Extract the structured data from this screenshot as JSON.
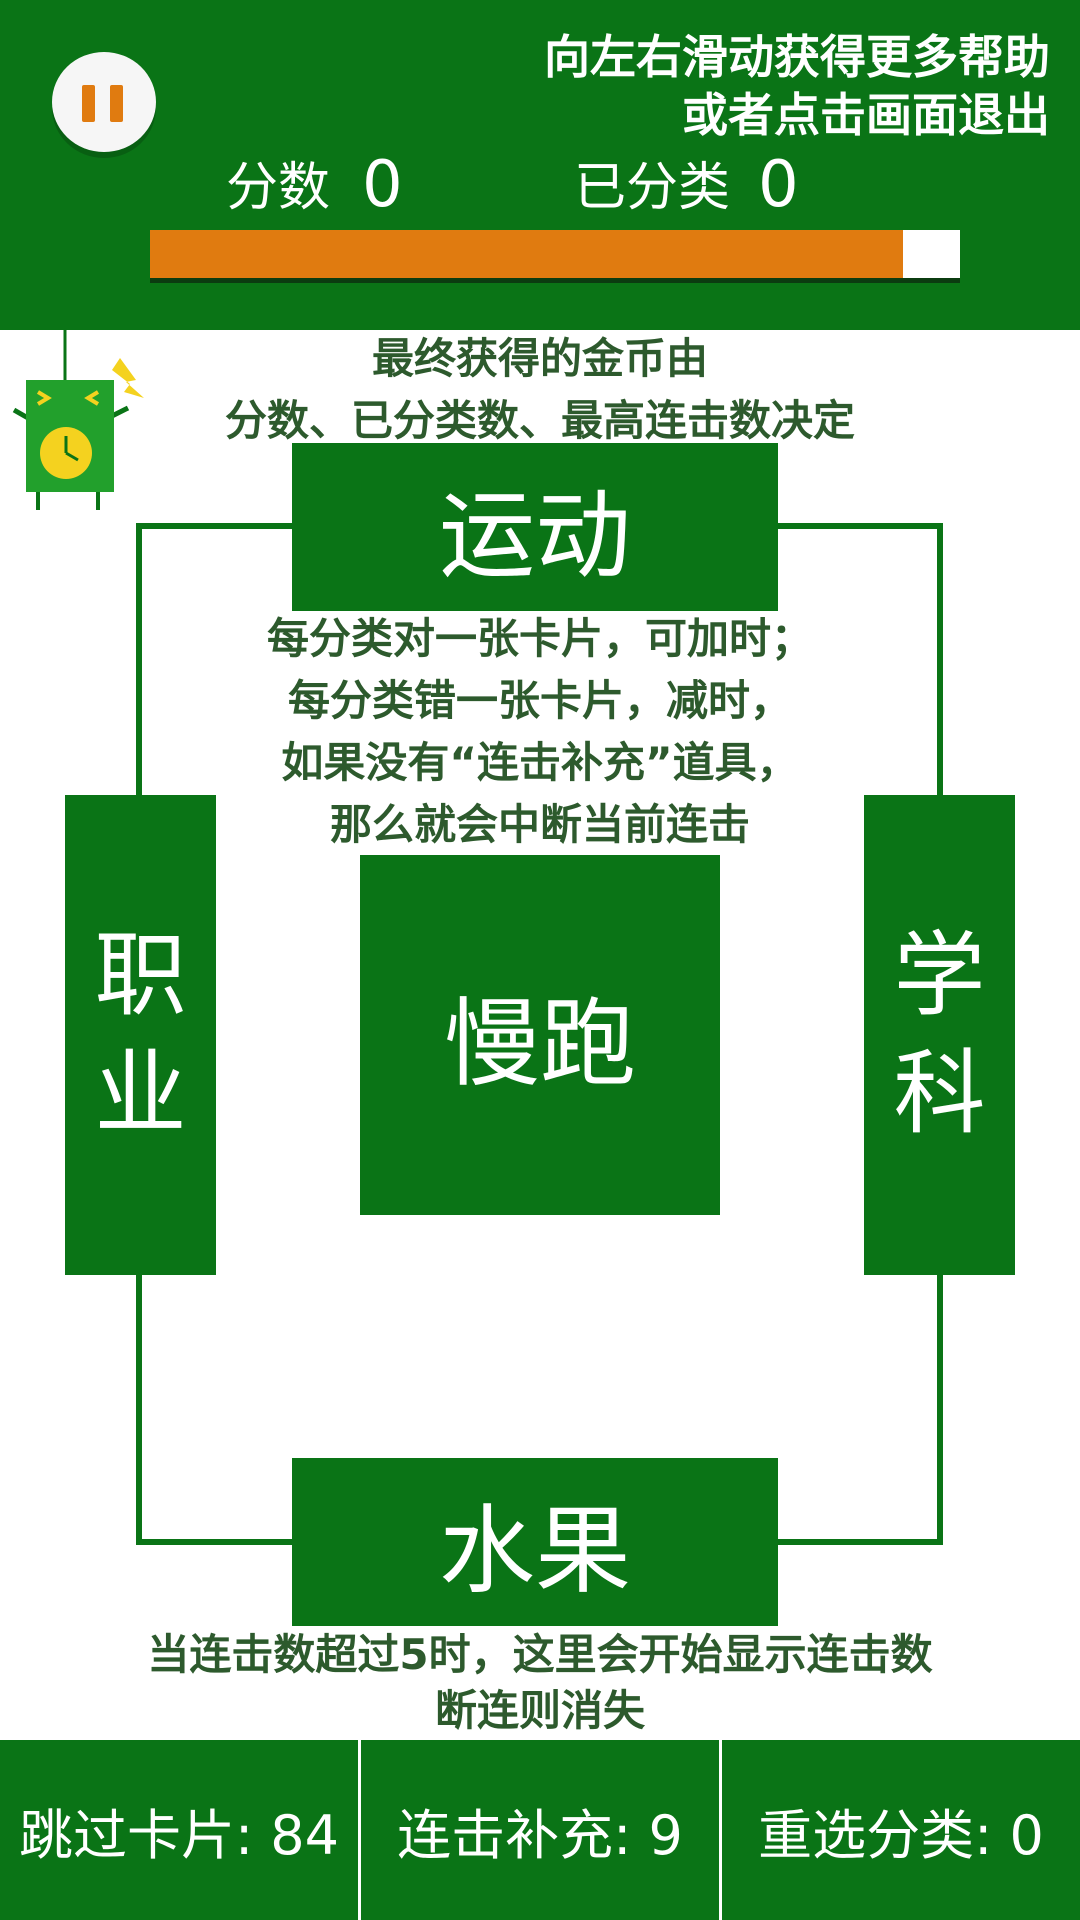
{
  "header": {
    "help_line1": "向左右滑动获得更多帮助",
    "help_line2": "或者点击画面退出",
    "score_label": "分数",
    "score_value": "0",
    "sorted_label": "已分类",
    "sorted_value": "0",
    "time_progress": 0.93,
    "colors": {
      "background": "#0a7416",
      "progress_fill": "#e07b10",
      "progress_track": "#ffffff"
    }
  },
  "pause_button": {
    "icon": "pause-icon"
  },
  "mascot": {
    "icon": "alarm-clock-mascot-icon"
  },
  "notes": {
    "coin_line1": "最终获得的金币由",
    "coin_line2": "分数、已分类数、最高连击数决定",
    "rule_line1": "每分类对一张卡片，可加时；",
    "rule_line2": "每分类错一张卡片，减时，",
    "rule_line3": "如果没有“连击补充”道具，",
    "rule_line4": "那么就会中断当前连击",
    "combo_line1": "当连击数超过5时，这里会开始显示连击数",
    "combo_line2": "断连则消失"
  },
  "categories": {
    "top": "运动",
    "left_1": "职",
    "left_2": "业",
    "right_1": "学",
    "right_2": "科",
    "bottom": "水果"
  },
  "current_card": "慢跑",
  "bottom_bar": {
    "skip": "跳过卡片: 84",
    "combo_refill": "连击补充: 9",
    "reselect": "重选分类: 0"
  }
}
